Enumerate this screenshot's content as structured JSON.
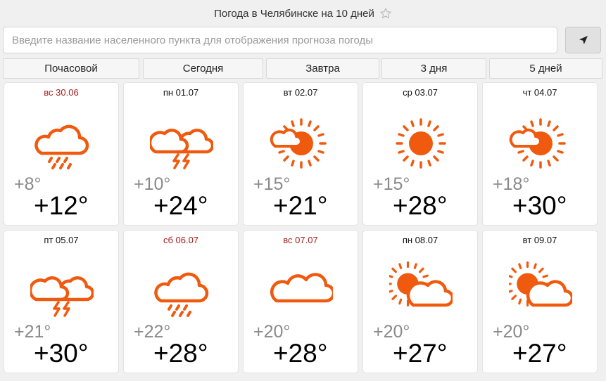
{
  "header": {
    "title": "Погода в Челябинске на 10 дней",
    "favorite_icon": "star-outline-icon"
  },
  "search": {
    "placeholder": "Введите название населенного пункта для отображения прогноза погоды",
    "value": "",
    "locate_icon": "location-arrow-icon"
  },
  "tabs": [
    {
      "label": "Почасовой"
    },
    {
      "label": "Сегодня"
    },
    {
      "label": "Завтра"
    },
    {
      "label": "3 дня"
    },
    {
      "label": "5 дней"
    }
  ],
  "colors": {
    "icon": "#f05a0f",
    "weekend": "#a51c1c",
    "min_temp": "#8a8a8a",
    "max_temp": "#000000"
  },
  "days": [
    {
      "date": "вс 30.06",
      "weekend": true,
      "icon": "cloud-rain-icon",
      "min": "+8°",
      "max": "+12°"
    },
    {
      "date": "пн 01.07",
      "weekend": false,
      "icon": "cloud-thunderstorm-icon",
      "min": "+10°",
      "max": "+24°"
    },
    {
      "date": "вт 02.07",
      "weekend": false,
      "icon": "sun-small-cloud-icon",
      "min": "+15°",
      "max": "+21°"
    },
    {
      "date": "ср 03.07",
      "weekend": false,
      "icon": "sun-icon",
      "min": "+15°",
      "max": "+28°"
    },
    {
      "date": "чт 04.07",
      "weekend": false,
      "icon": "sun-small-cloud-icon",
      "min": "+18°",
      "max": "+30°"
    },
    {
      "date": "пт 05.07",
      "weekend": false,
      "icon": "cloud-thunderstorm-icon",
      "min": "+21°",
      "max": "+30°"
    },
    {
      "date": "сб 06.07",
      "weekend": true,
      "icon": "cloud-rain-icon",
      "min": "+22°",
      "max": "+28°"
    },
    {
      "date": "вс 07.07",
      "weekend": true,
      "icon": "cloud-icon",
      "min": "+20°",
      "max": "+28°"
    },
    {
      "date": "пн 08.07",
      "weekend": false,
      "icon": "sun-behind-cloud-icon",
      "min": "+20°",
      "max": "+27°"
    },
    {
      "date": "вт 09.07",
      "weekend": false,
      "icon": "sun-behind-cloud-icon",
      "min": "+20°",
      "max": "+27°"
    }
  ]
}
